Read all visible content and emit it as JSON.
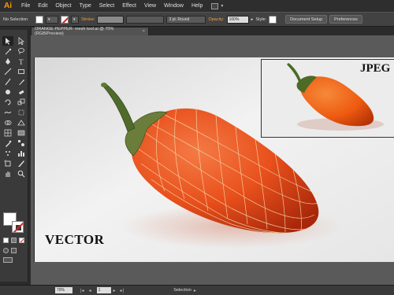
{
  "app": {
    "logo": "Ai"
  },
  "menu": [
    "File",
    "Edit",
    "Object",
    "Type",
    "Select",
    "Effect",
    "View",
    "Window",
    "Help"
  ],
  "control": {
    "selection": "No Selection",
    "stroke_label": "Stroke:",
    "brush": "3 pt. Round",
    "opacity_label": "Opacity:",
    "opacity_value": "100%",
    "style_label": "Style:",
    "doc_setup": "Document Setup",
    "preferences": "Preferences"
  },
  "document": {
    "tab_title": "ORANGE PEPPER- mesh tool.ai @ 70% (RGB/Preview)",
    "close": "×"
  },
  "artwork": {
    "vector_label": "VECTOR",
    "jpeg_label": "JPEG"
  },
  "status": {
    "zoom": "70%",
    "page": "1",
    "tool": "Selection"
  },
  "tools": [
    "selection-icon",
    "direct-selection-icon",
    "magic-wand-icon",
    "lasso-icon",
    "pen-icon",
    "type-icon",
    "line-icon",
    "rectangle-icon",
    "paintbrush-icon",
    "pencil-icon",
    "blob-brush-icon",
    "eraser-icon",
    "rotate-icon",
    "scale-icon",
    "warp-icon",
    "free-transform-icon",
    "shape-builder-icon",
    "perspective-icon",
    "mesh-icon",
    "gradient-icon",
    "eyedropper-icon",
    "blend-icon",
    "symbol-sprayer-icon",
    "column-graph-icon",
    "artboard-icon",
    "slice-icon",
    "hand-icon",
    "zoom-icon"
  ],
  "colors": {
    "accent": "#ff9a00",
    "pepper": "#e8501c",
    "stem": "#4f6a2a"
  }
}
